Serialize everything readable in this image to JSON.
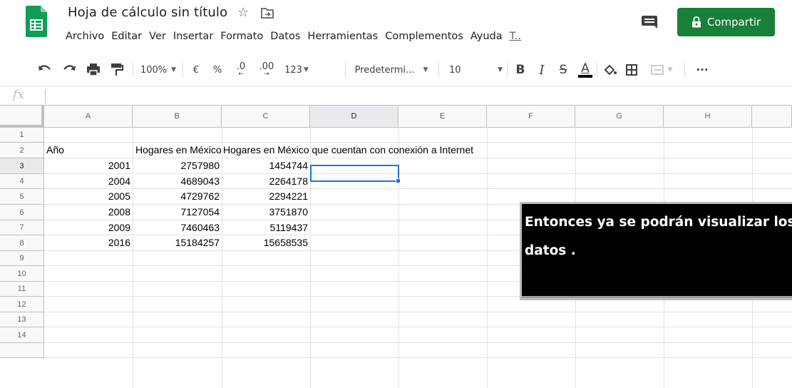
{
  "app": {
    "title": "Hoja de cálculo sin título",
    "share_label": "Compartir",
    "accent_color": "#188038",
    "icons": [
      "sheets-logo",
      "star-icon",
      "move-to-folder-icon",
      "comments-icon",
      "lock-icon"
    ]
  },
  "menu": [
    "Archivo",
    "Editar",
    "Ver",
    "Insertar",
    "Formato",
    "Datos",
    "Herramientas",
    "Complementos",
    "Ayuda",
    "T.."
  ],
  "toolbar": {
    "zoom": "100%",
    "currency": "€",
    "percent": "%",
    "decrease_decimals": ".0",
    "increase_decimals": ".00",
    "more_formats": "123",
    "font": "Predetermi...",
    "font_size": "10",
    "bold": "B",
    "italic": "I",
    "strikethrough": "S",
    "text_color": "A",
    "more": "···"
  },
  "formula_bar": {
    "label": "fx",
    "value": ""
  },
  "sheet": {
    "columns": [
      "A",
      "B",
      "C",
      "D",
      "E",
      "F",
      "G",
      "H"
    ],
    "rows": [
      "1",
      "2",
      "3",
      "4",
      "5",
      "6",
      "7",
      "8",
      "9",
      "10",
      "11",
      "12",
      "13",
      "14"
    ],
    "selected_cell": "D3",
    "header_row": {
      "a": "Año",
      "b": "Hogares en México con computadora",
      "c": "Hogares en México que cuentan con conexión a Internet"
    },
    "data": [
      {
        "year": "2001",
        "computers": "2757980",
        "internet": "1454744"
      },
      {
        "year": "2004",
        "computers": "4689043",
        "internet": "2264178"
      },
      {
        "year": "2005",
        "computers": "4729762",
        "internet": "2294221"
      },
      {
        "year": "2008",
        "computers": "7127054",
        "internet": "3751870"
      },
      {
        "year": "2009",
        "computers": "7460463",
        "internet": "5119437"
      },
      {
        "year": "2016",
        "computers": "15184257",
        "internet": "15658535"
      }
    ]
  },
  "caption": {
    "line1": "Entonces ya se podrán visualizar los",
    "line2": "datos ."
  }
}
